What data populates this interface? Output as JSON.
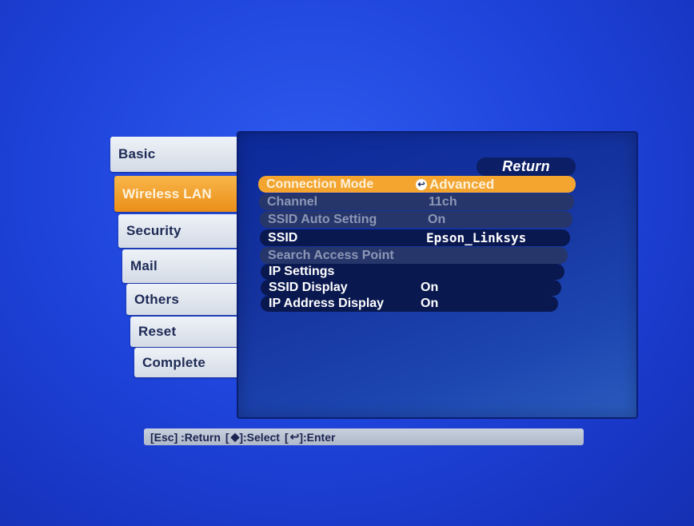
{
  "tabs": [
    {
      "label": "Basic",
      "active": false
    },
    {
      "label": "Wireless LAN",
      "active": true
    },
    {
      "label": "Security",
      "active": false
    },
    {
      "label": "Mail",
      "active": false
    },
    {
      "label": "Others",
      "active": false
    },
    {
      "label": "Reset",
      "active": false
    },
    {
      "label": "Complete",
      "active": false
    }
  ],
  "panel": {
    "return_label": "Return",
    "rows": [
      {
        "label": "Connection Mode",
        "value": "Advanced",
        "state": "selected",
        "value_icon": "enter-icon"
      },
      {
        "label": "Channel",
        "value": "11ch",
        "state": "disabled"
      },
      {
        "label": "SSID Auto Setting",
        "value": "On",
        "state": "disabled"
      },
      {
        "label": "SSID",
        "value": "Epson_Linksys",
        "state": "normal"
      },
      {
        "label": "Search Access Point",
        "value": "",
        "state": "disabled"
      },
      {
        "label": "IP Settings",
        "value": "",
        "state": "normal"
      },
      {
        "label": "SSID Display",
        "value": "On",
        "state": "normal"
      },
      {
        "label": "IP Address Display",
        "value": "On",
        "state": "normal"
      }
    ]
  },
  "help": {
    "esc": "[Esc] :Return",
    "select": "]:Select",
    "select_key_open": "[",
    "select_icon": "up-down-arrow-icon",
    "enter_key_open": "[",
    "enter": "]:Enter",
    "enter_icon": "enter-icon"
  },
  "colors": {
    "background": "#1f45dc",
    "highlight": "#f3a530",
    "panel": "#15339e"
  }
}
